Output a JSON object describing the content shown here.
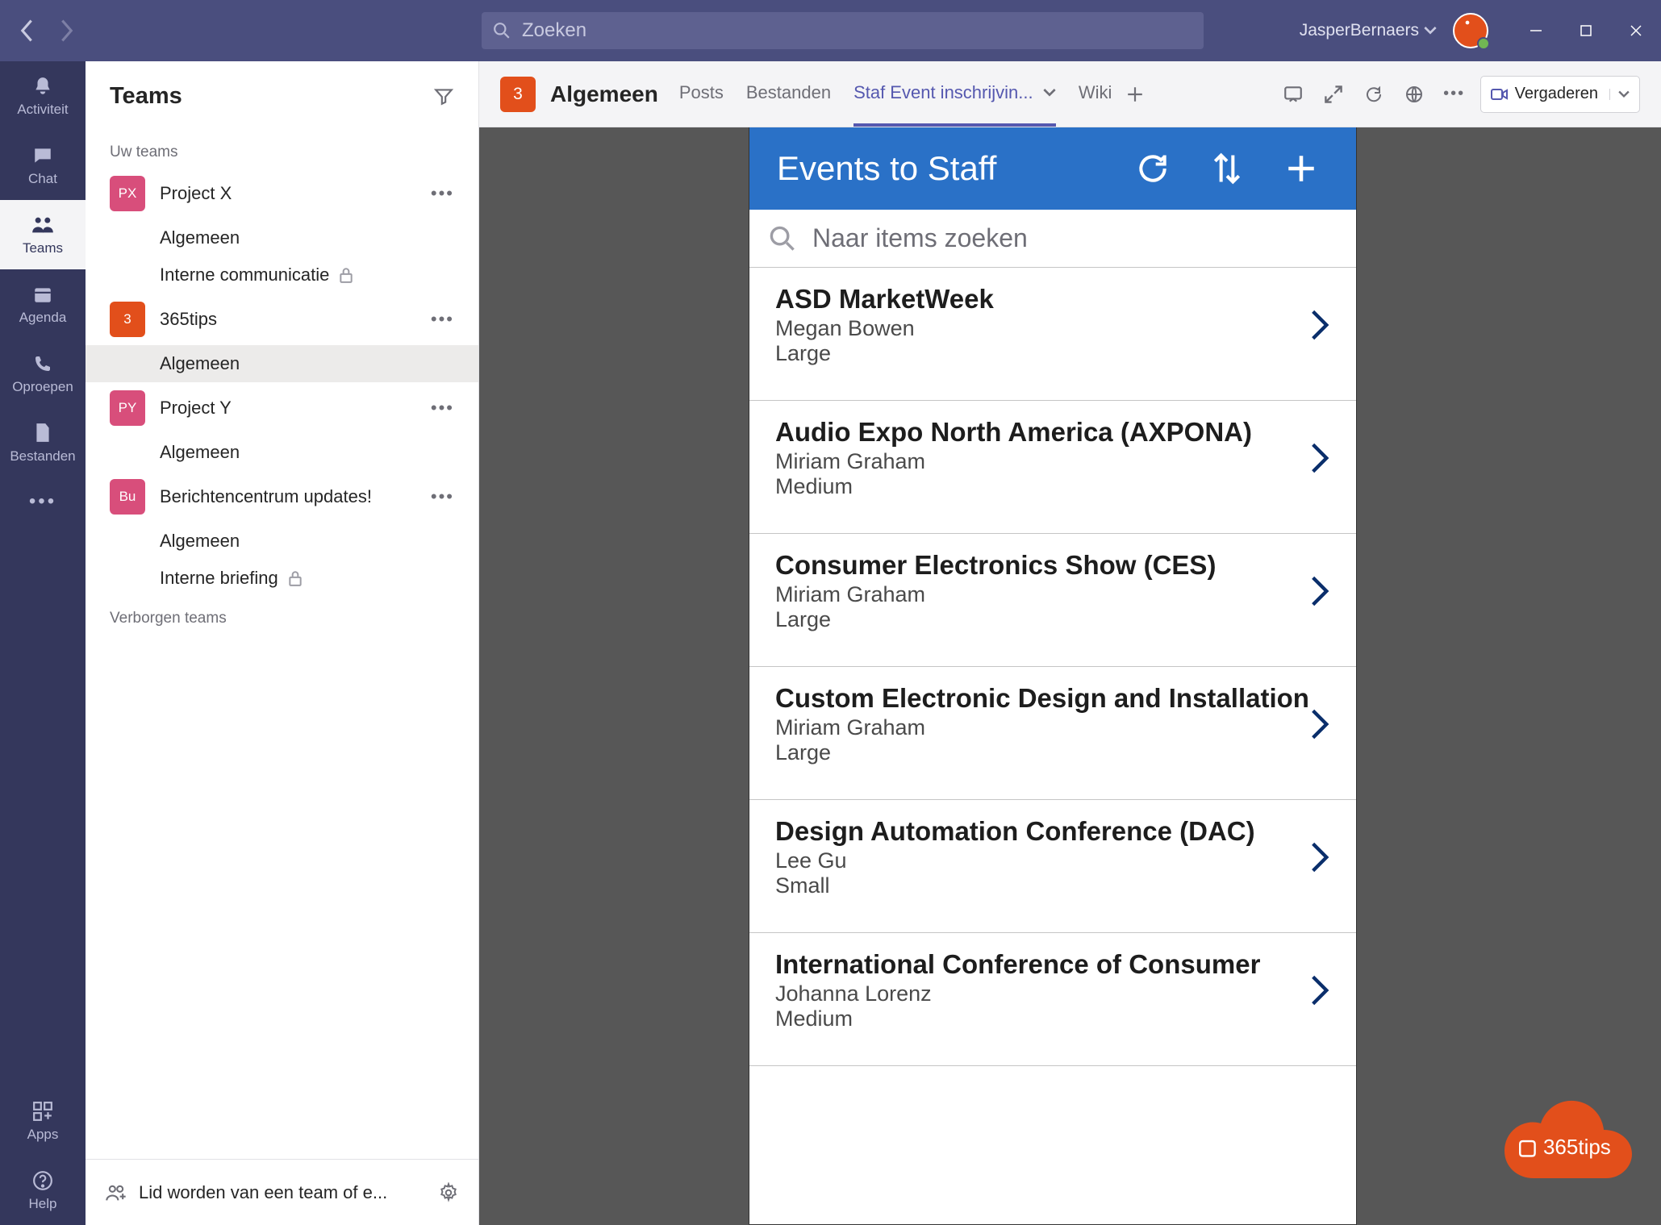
{
  "titlebar": {
    "search_placeholder": "Zoeken",
    "user_name": "JasperBernaers"
  },
  "rail": {
    "items": [
      {
        "label": "Activiteit"
      },
      {
        "label": "Chat"
      },
      {
        "label": "Teams"
      },
      {
        "label": "Agenda"
      },
      {
        "label": "Oproepen"
      },
      {
        "label": "Bestanden"
      }
    ],
    "apps_label": "Apps",
    "help_label": "Help"
  },
  "sidebar": {
    "title": "Teams",
    "your_teams_label": "Uw teams",
    "hidden_teams_label": "Verborgen teams",
    "teams": [
      {
        "tile": "PX",
        "tile_color": "pink",
        "name": "Project X",
        "channels": [
          {
            "name": "Algemeen"
          },
          {
            "name": "Interne communicatie",
            "private": true
          }
        ]
      },
      {
        "tile": "3",
        "tile_color": "orange",
        "name": "365tips",
        "channels": [
          {
            "name": "Algemeen",
            "selected": true
          }
        ]
      },
      {
        "tile": "PY",
        "tile_color": "pink",
        "name": "Project Y",
        "channels": [
          {
            "name": "Algemeen"
          }
        ]
      },
      {
        "tile": "Bu",
        "tile_color": "pink",
        "name": "Berichtencentrum updates!",
        "channels": [
          {
            "name": "Algemeen"
          },
          {
            "name": "Interne briefing",
            "private": true
          }
        ]
      }
    ],
    "join_label": "Lid worden van een team of e..."
  },
  "channel_header": {
    "tile": "3",
    "name": "Algemeen",
    "tabs": [
      {
        "label": "Posts"
      },
      {
        "label": "Bestanden"
      },
      {
        "label": "Staf Event inschrijvin...",
        "active": true,
        "has_chevron": true
      },
      {
        "label": "Wiki"
      }
    ],
    "meet_label": "Vergaderen"
  },
  "events_app": {
    "title": "Events to Staff",
    "search_placeholder": "Naar items zoeken",
    "events": [
      {
        "title": "ASD MarketWeek",
        "person": "Megan Bowen",
        "size": "Large"
      },
      {
        "title": "Audio Expo North America (AXPONA)",
        "person": "Miriam Graham",
        "size": "Medium"
      },
      {
        "title": "Consumer Electronics Show (CES)",
        "person": "Miriam Graham",
        "size": "Large"
      },
      {
        "title": "Custom Electronic Design and Installation",
        "person": "Miriam Graham",
        "size": "Large"
      },
      {
        "title": "Design Automation Conference (DAC)",
        "person": "Lee Gu",
        "size": "Small"
      },
      {
        "title": "International Conference of Consumer",
        "person": "Johanna Lorenz",
        "size": "Medium"
      }
    ]
  },
  "cloud_badge": {
    "text": "365tips"
  }
}
